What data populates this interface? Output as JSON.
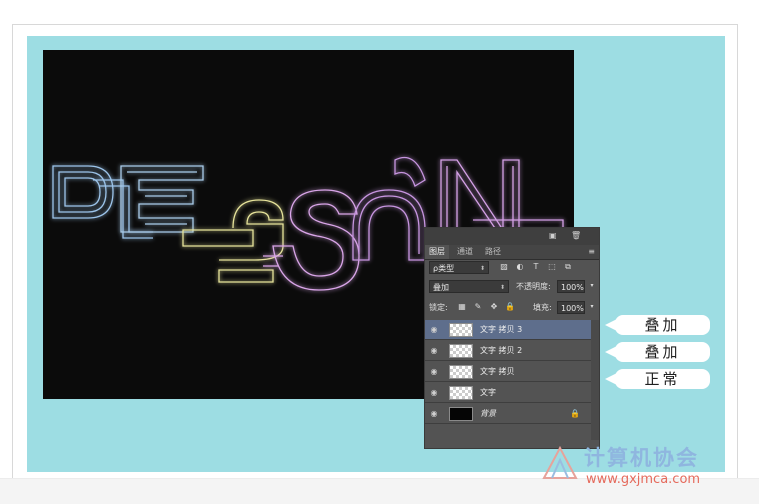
{
  "artwork": {
    "letters": "DESIGN"
  },
  "panel": {
    "tabs": [
      "图层",
      "通道",
      "路径"
    ],
    "filter_label": "ρ类型",
    "blend_mode": "叠加",
    "opacity_label": "不透明度:",
    "opacity_value": "100%",
    "lock_label": "锁定:",
    "fill_label": "填充:",
    "fill_value": "100%",
    "layers": [
      {
        "name": "文字 拷贝 3",
        "selected": true
      },
      {
        "name": "文字 拷贝 2",
        "selected": false
      },
      {
        "name": "文字 拷贝",
        "selected": false
      },
      {
        "name": "文字",
        "selected": false
      },
      {
        "name": "背景",
        "selected": false
      }
    ]
  },
  "callouts": [
    "叠加",
    "叠加",
    "正常"
  ],
  "watermark": {
    "title": "计算机协会",
    "url": "www.gxjmca.com"
  },
  "colors": {
    "background_panel": "#9ddde3",
    "canvas": "#0b0b0b",
    "selected_layer": "#5e6e8c"
  }
}
